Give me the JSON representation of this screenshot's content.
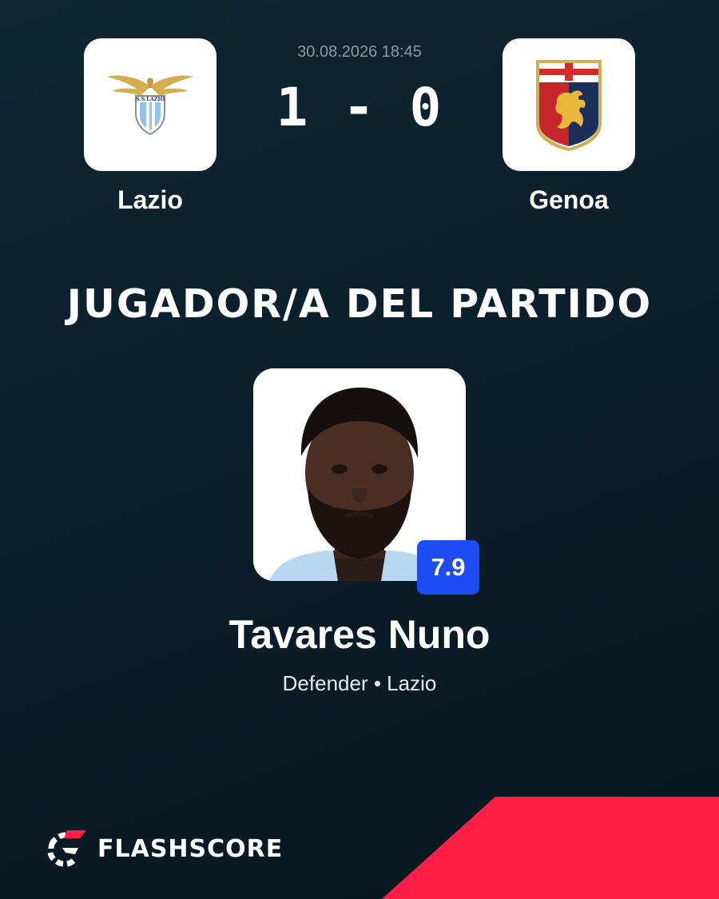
{
  "match": {
    "datetime": "30.08.2026 18:45",
    "score": "1 - 0",
    "home": {
      "name": "Lazio",
      "crest_text": "S.S.LAZIO",
      "logo_icon": "lazio-eagle-crest"
    },
    "away": {
      "name": "Genoa",
      "logo_icon": "genoa-griffin-crest"
    }
  },
  "headline": "JUGADOR/A DEL PARTIDO",
  "player": {
    "name": "Tavares Nuno",
    "meta": "Defender • Lazio",
    "rating": "7.9",
    "photo_icon": "player-portrait"
  },
  "brand": {
    "name": "FLASHSCORE",
    "logo_icon": "flashscore-logo-icon"
  },
  "colors": {
    "background": "#0a1f2b",
    "accent_red": "#ff1e46",
    "rating_blue": "#1d4cf5",
    "muted_text": "#8a9aa3"
  }
}
